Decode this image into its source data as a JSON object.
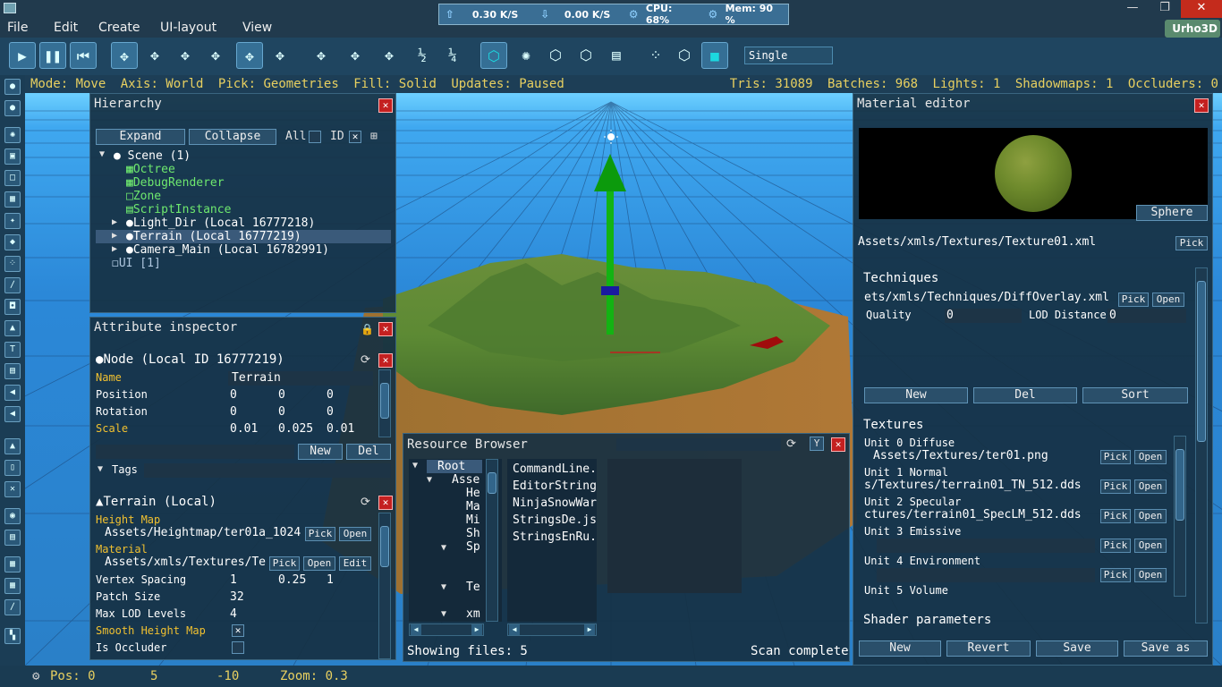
{
  "menubar": {
    "items": [
      "File",
      "Edit",
      "Create",
      "UI-layout",
      "View"
    ],
    "logo": "Urho3D"
  },
  "perf": {
    "upload": "0.30 K/S",
    "download": "0.00 K/S",
    "cpu": "CPU: 68%",
    "mem": "Mem: 90 %"
  },
  "toolbar": {
    "fill_mode_select": "Single"
  },
  "status": {
    "mode": "Mode: Move",
    "axis": "Axis: World",
    "pick": "Pick: Geometries",
    "fill": "Fill: Solid",
    "updates": "Updates: Paused",
    "tris": "Tris: 31089",
    "batches": "Batches: 968",
    "lights": "Lights: 1",
    "shadowmaps": "Shadowmaps: 1",
    "occluders": "Occluders: 0"
  },
  "hierarchy": {
    "title": "Hierarchy",
    "expand": "Expand",
    "collapse": "Collapse",
    "all": "All",
    "id": "ID",
    "items": {
      "scene": "Scene (1)",
      "octree": "Octree",
      "debug": "DebugRenderer",
      "zone": "Zone",
      "script": "ScriptInstance",
      "light": "Light_Dir (Local 16777218)",
      "terrain": "Terrain (Local 16777219)",
      "camera": "Camera_Main (Local 16782991)",
      "ui": "UI [1]"
    }
  },
  "inspector": {
    "title": "Attribute inspector",
    "node_title": "Node (Local ID 16777219)",
    "name_label": "Name",
    "name_value": "Terrain",
    "position_label": "Position",
    "position": [
      "0",
      "0",
      "0"
    ],
    "rotation_label": "Rotation",
    "rotation": [
      "0",
      "0",
      "0"
    ],
    "scale_label": "Scale",
    "scale": [
      "0.01",
      "0.025",
      "0.01"
    ],
    "new": "New",
    "del": "Del",
    "tags": "Tags",
    "terrain_title": "Terrain (Local)",
    "heightmap_label": "Height Map",
    "heightmap_value": "Assets/Heightmap/ter01a_1024",
    "pick": "Pick",
    "open": "Open",
    "edit": "Edit",
    "material_label": "Material",
    "material_value": "Assets/xmls/Textures/Te",
    "vertex_label": "Vertex Spacing",
    "vertex": [
      "1",
      "0.25",
      "1"
    ],
    "patch_label": "Patch Size",
    "patch_value": "32",
    "lod_label": "Max LOD Levels",
    "lod_value": "4",
    "smooth_label": "Smooth Height Map",
    "occluder_label": "Is Occluder"
  },
  "resource": {
    "title": "Resource Browser",
    "tree": [
      "Root",
      "Asse",
      "He",
      "Ma",
      "Mi",
      "Sh",
      "Sp",
      "Te",
      "xm"
    ],
    "files": [
      "CommandLine.",
      "EditorString",
      "NinjaSnowWar",
      "StringsDe.js",
      "StringsEnRu."
    ],
    "showing": "Showing files: 5",
    "scan": "Scan complete"
  },
  "material": {
    "title": "Material editor",
    "preview_mode": "Sphere",
    "path": "Assets/xmls/Textures/Texture01.xml",
    "pick": "Pick",
    "open": "Open",
    "techniques_label": "Techniques",
    "technique_path": "ets/xmls/Techniques/DiffOverlay.xml",
    "quality_label": "Quality",
    "quality_value": "0",
    "lod_label": "LOD Distance",
    "lod_value": "0",
    "new": "New",
    "del": "Del",
    "sort": "Sort",
    "textures_label": "Textures",
    "units": [
      {
        "label": "Unit 0 Diffuse",
        "path": "Assets/Textures/ter01.png"
      },
      {
        "label": "Unit 1 Normal",
        "path": "s/Textures/terrain01_TN_512.dds"
      },
      {
        "label": "Unit 2 Specular",
        "path": "ctures/terrain01_SpecLM_512.dds"
      },
      {
        "label": "Unit 3 Emissive",
        "path": ""
      },
      {
        "label": "Unit 4 Environment",
        "path": ""
      },
      {
        "label": "Unit 5 Volume",
        "path": ""
      }
    ],
    "shader_label": "Shader parameters",
    "btn_new": "New",
    "btn_revert": "Revert",
    "btn_save": "Save",
    "btn_saveas": "Save as"
  },
  "bottom": {
    "pos": "Pos: 0",
    "y": "5",
    "z": "-10",
    "zoom": "Zoom: 0.3"
  }
}
